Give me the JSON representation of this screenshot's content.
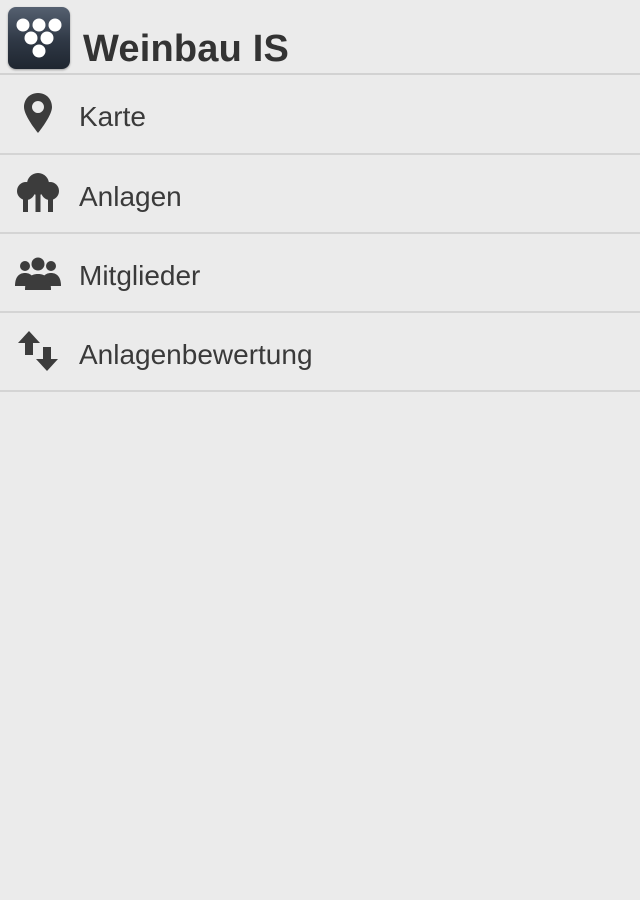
{
  "app": {
    "title": "Weinbau IS",
    "icon": "grape-cluster-icon"
  },
  "menu": {
    "items": [
      {
        "label": "Karte",
        "icon": "map-pin-icon"
      },
      {
        "label": "Anlagen",
        "icon": "trees-icon"
      },
      {
        "label": "Mitglieder",
        "icon": "people-group-icon"
      },
      {
        "label": "Anlagenbewertung",
        "icon": "up-down-arrows-icon"
      }
    ]
  },
  "colors": {
    "background": "#ebebeb",
    "text": "#333333",
    "divider": "#d4d4d4",
    "icon_fill": "#3c3c3c"
  }
}
